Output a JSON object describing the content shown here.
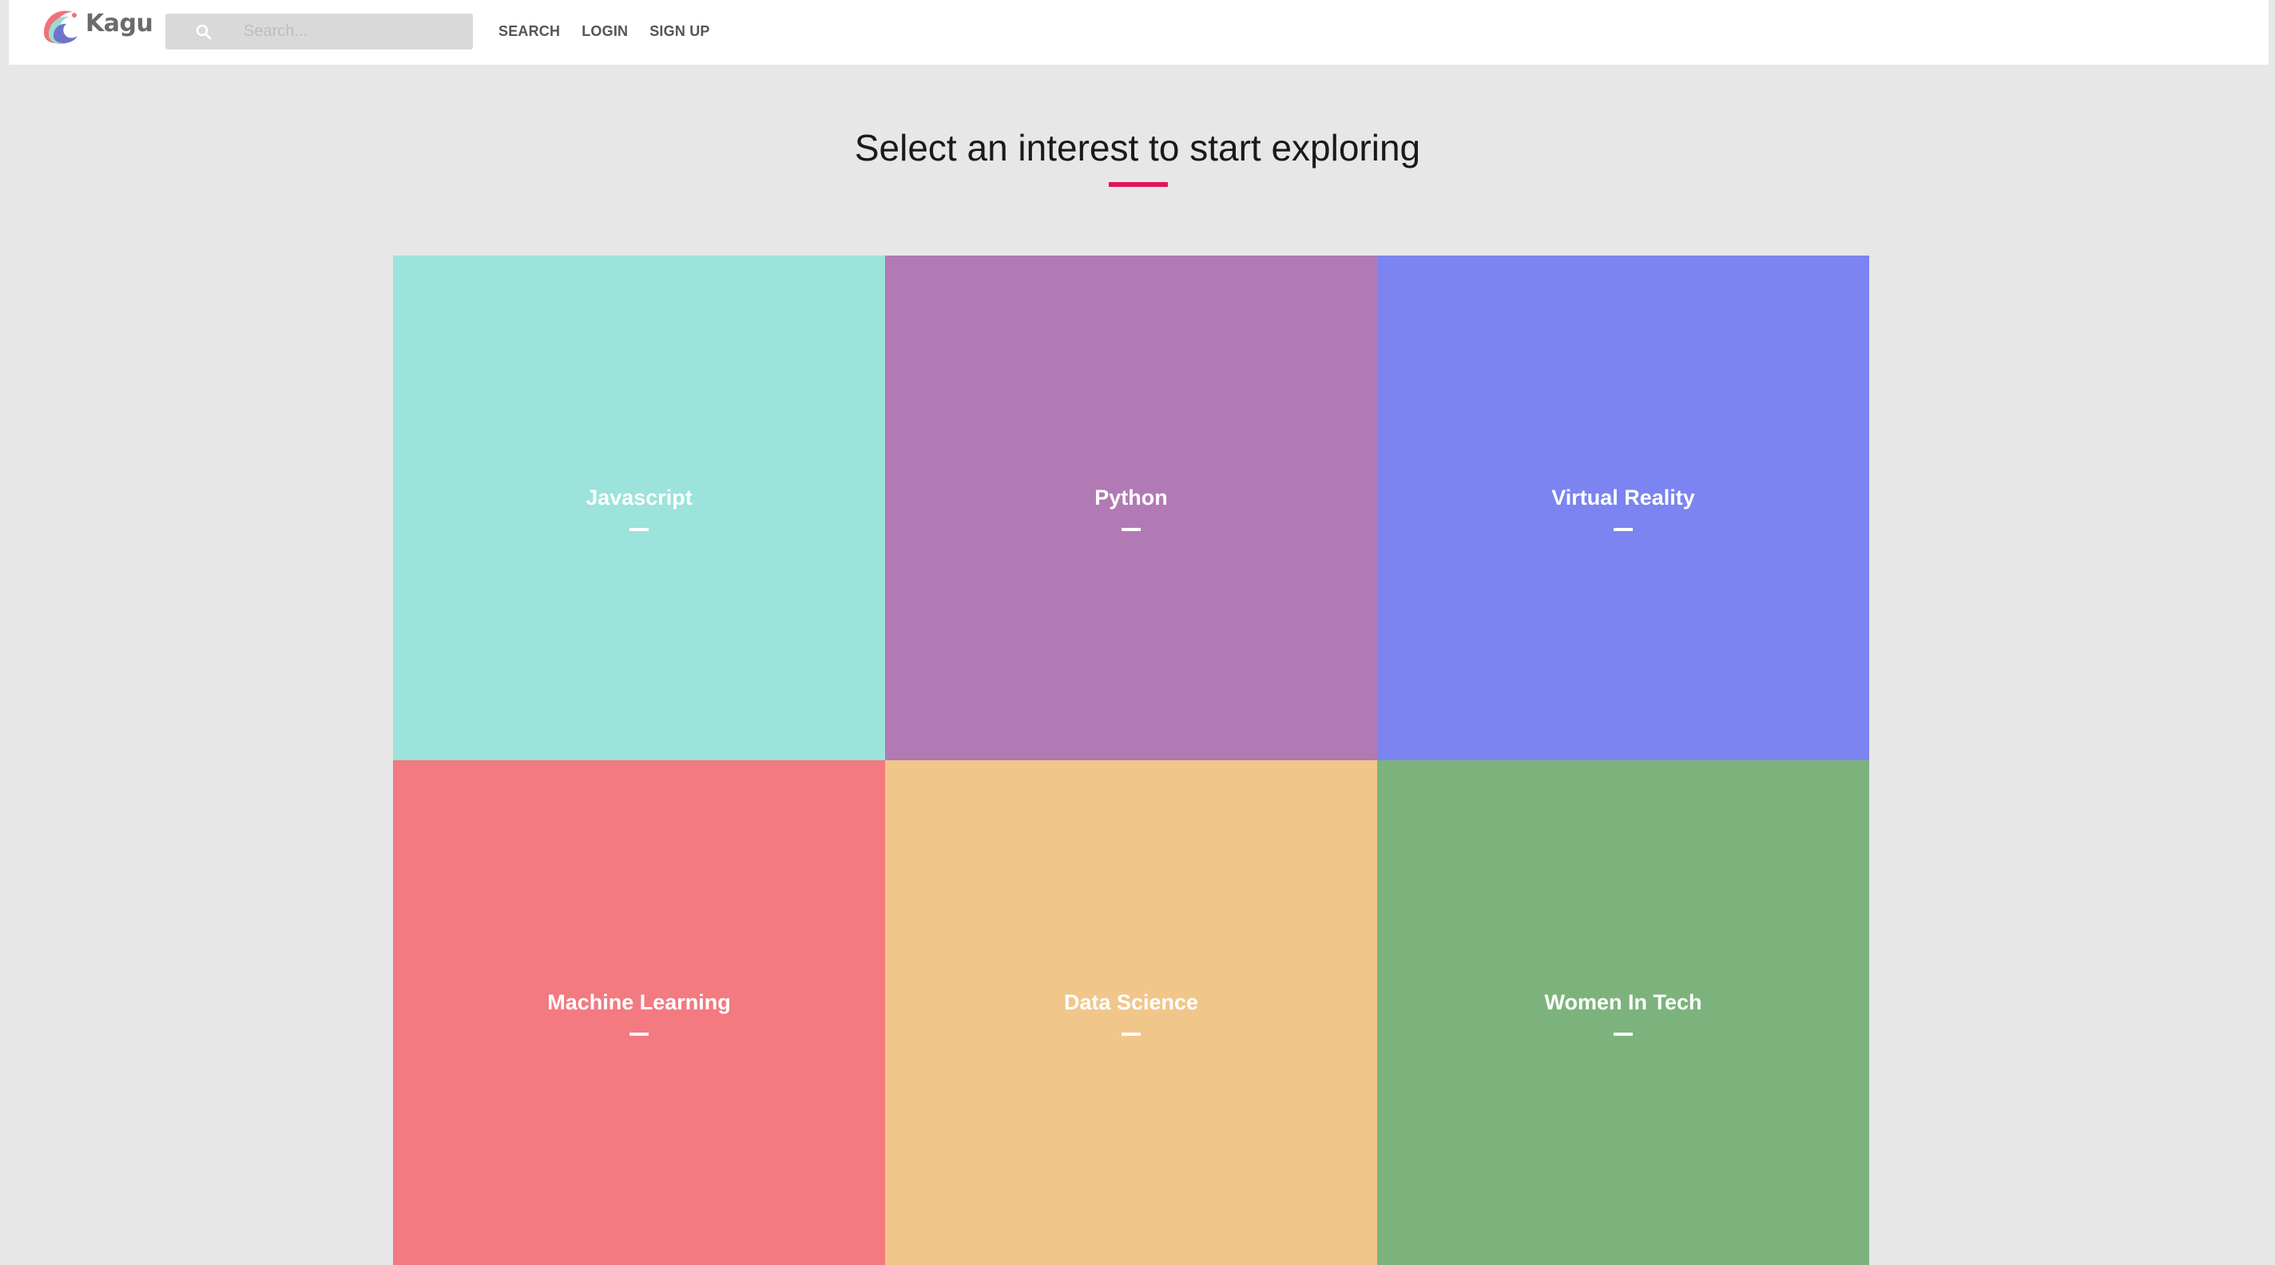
{
  "brand": {
    "name": "Kagu",
    "text_color": "#6b6b6b"
  },
  "search": {
    "placeholder": "Search...",
    "value": ""
  },
  "nav": {
    "items": [
      {
        "label": "SEARCH"
      },
      {
        "label": "LOGIN"
      },
      {
        "label": "SIGN UP"
      }
    ]
  },
  "main": {
    "title": "Select an interest to start exploring",
    "accent_color": "#e0145e"
  },
  "interests": [
    {
      "label": "Javascript",
      "color": "#9ce3db"
    },
    {
      "label": "Python",
      "color": "#b17ab4"
    },
    {
      "label": "Virtual Reality",
      "color": "#7b84f0"
    },
    {
      "label": "Machine Learning",
      "color": "#f27a80"
    },
    {
      "label": "Data Science",
      "color": "#f1c68b"
    },
    {
      "label": "Women In Tech",
      "color": "#7cb37c"
    }
  ]
}
